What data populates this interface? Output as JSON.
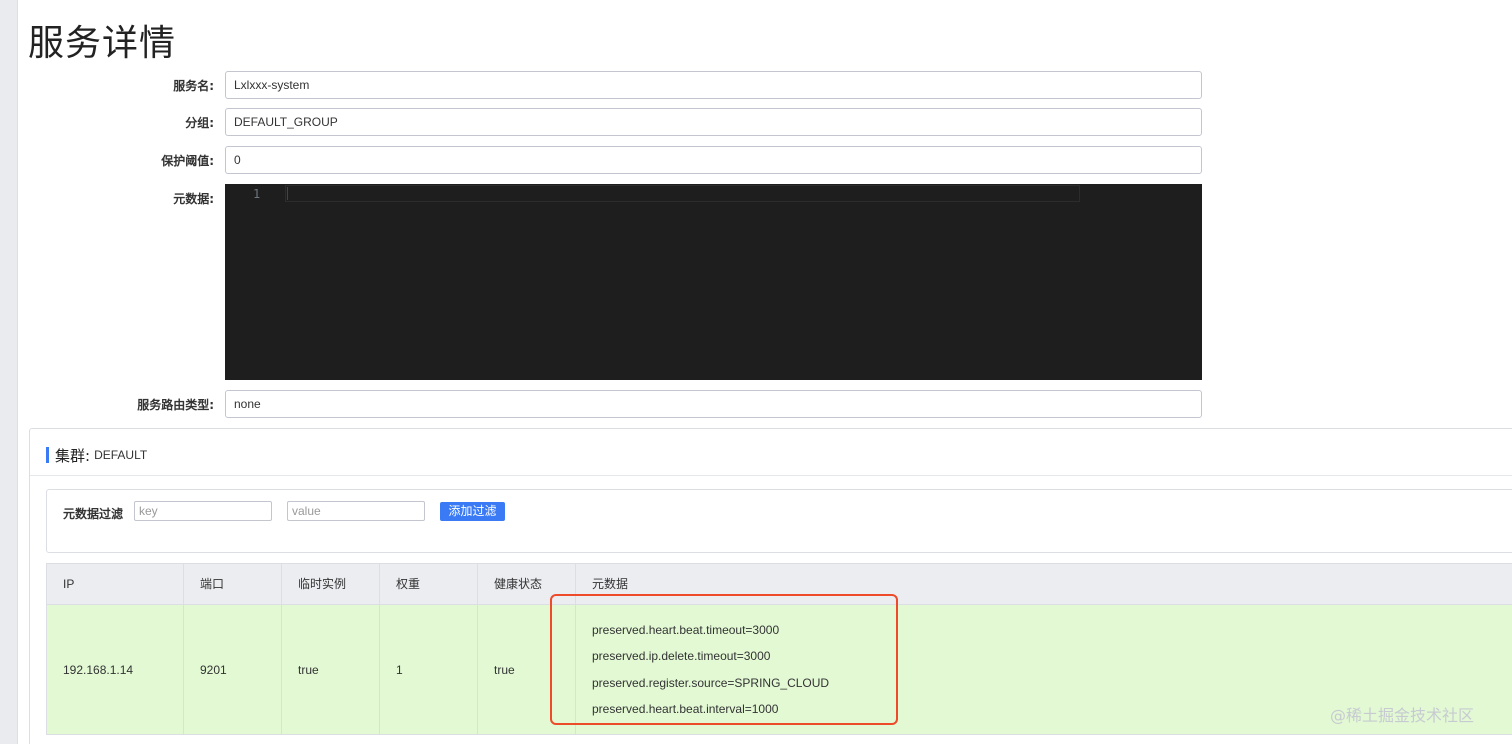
{
  "page": {
    "title": "服务详情"
  },
  "form": {
    "service_name": {
      "label": "服务名:",
      "value": "Lxlxxx-system"
    },
    "group": {
      "label": "分组:",
      "value": "DEFAULT_GROUP"
    },
    "protect_threshold": {
      "label": "保护阈值:",
      "value": "0"
    },
    "metadata": {
      "label": "元数据:",
      "line_number": "1"
    },
    "selector_type": {
      "label": "服务路由类型:",
      "value": "none"
    }
  },
  "cluster": {
    "label": "集群:",
    "name": "DEFAULT",
    "filter": {
      "label": "元数据过滤",
      "key_placeholder": "key",
      "value_placeholder": "value",
      "add_button": "添加过滤"
    },
    "table": {
      "headers": [
        "IP",
        "端口",
        "临时实例",
        "权重",
        "健康状态",
        "元数据"
      ],
      "rows": [
        {
          "ip": "192.168.1.14",
          "port": "9201",
          "ephemeral": "true",
          "weight": "1",
          "healthy": "true",
          "metadata": [
            "preserved.heart.beat.timeout=3000",
            "preserved.ip.delete.timeout=3000",
            "preserved.register.source=SPRING_CLOUD",
            "preserved.heart.beat.interval=1000"
          ]
        }
      ]
    }
  },
  "annotation": {
    "highlight_color": "#ee4b2b"
  },
  "watermark": "@稀土掘金技术社区"
}
